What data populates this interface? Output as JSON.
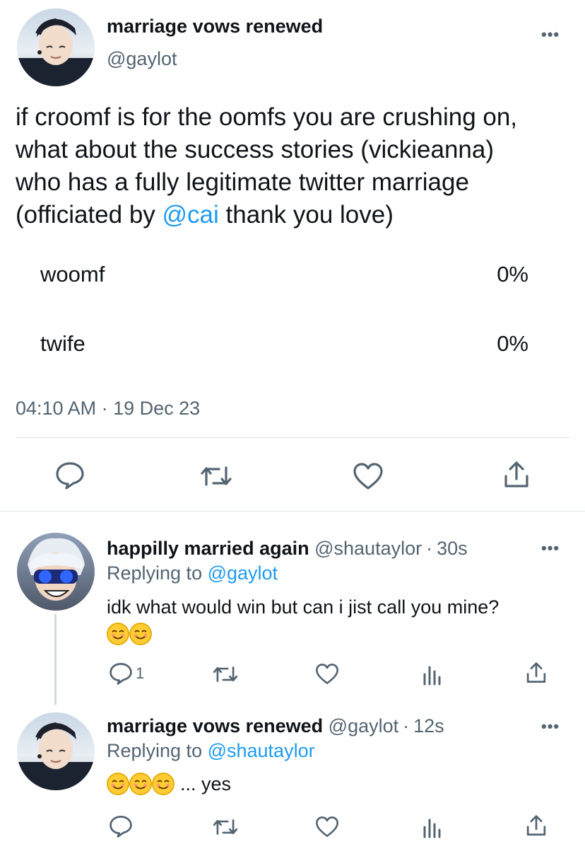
{
  "main_tweet": {
    "display_name": "marriage vows renewed",
    "handle": "@gaylot",
    "text_lines": [
      "if croomf is for the oomfs you are crushing on,",
      "what about the success stories (vickieanna)",
      "who has a fully legitimate twitter marriage"
    ],
    "last_line_prefix": "(officiated by ",
    "mention": "@cai",
    "last_line_suffix": " thank you love)",
    "poll": [
      {
        "label": "woomf",
        "percent": "0%"
      },
      {
        "label": "twife",
        "percent": "0%"
      }
    ],
    "timestamp": "04:10 AM",
    "separator": "·",
    "date": "19 Dec 23"
  },
  "reply1": {
    "display_name": "happilly married again",
    "handle": "@shautaylor",
    "dot": "·",
    "time": "30s",
    "replying_prefix": "Replying to ",
    "replying_to": "@gaylot",
    "text": "idk what would win but can i jist call you mine?",
    "reply_count": "1"
  },
  "reply2": {
    "display_name": "marriage vows renewed",
    "handle": "@gaylot",
    "dot": "·",
    "time": "12s",
    "replying_prefix": "Replying to ",
    "replying_to": "@shautaylor",
    "text": "... yes"
  },
  "ui": {
    "more_label": "•••",
    "icons": [
      "reply-icon",
      "retweet-icon",
      "like-icon",
      "share-icon",
      "analytics-icon"
    ],
    "accent": "#1d9bf0",
    "muted": "#536471"
  }
}
